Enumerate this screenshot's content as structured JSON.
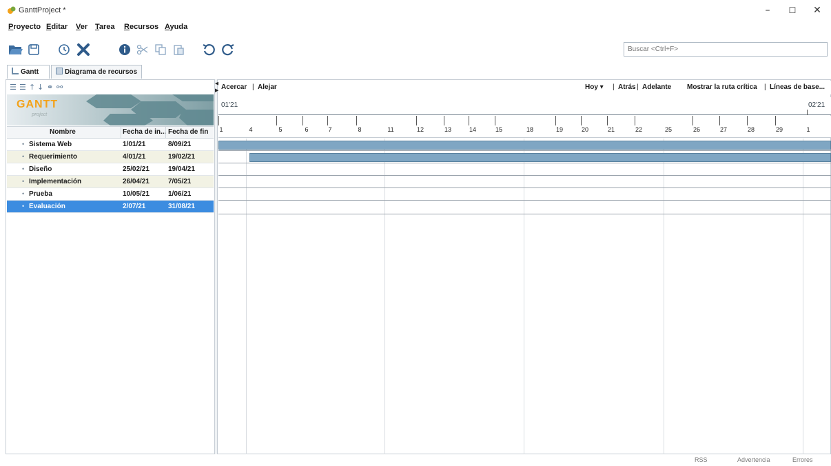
{
  "window": {
    "title": "GanttProject *",
    "controls": [
      "–",
      "☐",
      "✕"
    ]
  },
  "menu": {
    "items": [
      {
        "first": "P",
        "rest": "royecto"
      },
      {
        "first": "E",
        "rest": "ditar"
      },
      {
        "first": "V",
        "rest": "er"
      },
      {
        "first": "T",
        "rest": "area"
      },
      {
        "first": "R",
        "rest": "ecursos"
      },
      {
        "first": "A",
        "rest": "yuda"
      }
    ]
  },
  "toolbar": {
    "icons": [
      "open-folder-icon",
      "save-icon",
      "clock-icon",
      "delete-icon",
      "info-icon",
      "cut-icon",
      "copy-icon",
      "paste-icon",
      "undo-icon",
      "redo-icon"
    ],
    "search_placeholder": "Buscar <Ctrl+F>",
    "colors": {
      "accent": "#3d6ea5",
      "delete": "#2f5b8a",
      "folder": "#3b6c9e"
    }
  },
  "tabs": [
    {
      "label": "Gantt",
      "active": true
    },
    {
      "label": "Diagrama de recursos",
      "active": false
    }
  ],
  "tree": {
    "logo_text": "GANTT",
    "logo_sub": "project",
    "columns": [
      "Nombre",
      "Fecha de in...",
      "Fecha de fin"
    ],
    "tasks": [
      {
        "name": "Sistema Web",
        "start": "1/01/21",
        "end": "8/09/21"
      },
      {
        "name": "Requerimiento",
        "start": "4/01/21",
        "end": "19/02/21"
      },
      {
        "name": "Diseño",
        "start": "25/02/21",
        "end": "19/04/21"
      },
      {
        "name": "Implementación",
        "start": "26/04/21",
        "end": "7/05/21"
      },
      {
        "name": "Prueba",
        "start": "10/05/21",
        "end": "1/06/21"
      },
      {
        "name": "Evaluación",
        "start": "2/07/21",
        "end": "31/08/21"
      }
    ],
    "selected_index": 5
  },
  "chart": {
    "zoom_in": "Acercar",
    "zoom_out": "Alejar",
    "separator": "|",
    "today": "Hoy ▾",
    "back": "Atrás",
    "forward": "Adelante",
    "critical_path": "Mostrar la ruta crítica",
    "baselines": "Líneas de base...",
    "months": [
      "01'21",
      "02'21"
    ],
    "days": [
      "1",
      "4",
      "5",
      "6",
      "7",
      "8",
      "11",
      "12",
      "13",
      "14",
      "15",
      "18",
      "19",
      "20",
      "21",
      "22",
      "25",
      "26",
      "27",
      "28",
      "29",
      "1"
    ]
  },
  "status": {
    "rss": "RSS",
    "warning": "Advertencia",
    "errors": "Errores"
  }
}
